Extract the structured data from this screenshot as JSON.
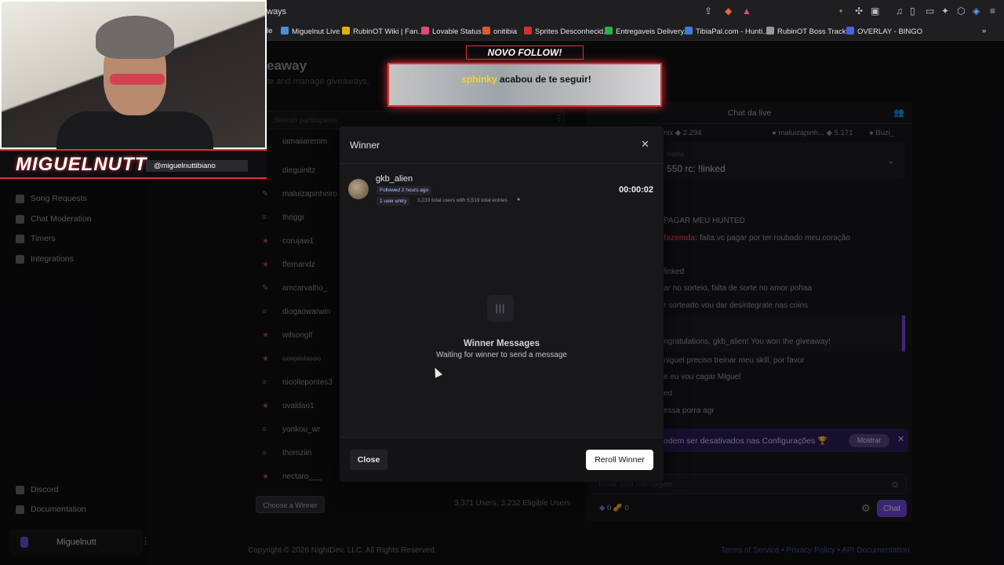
{
  "browser": {
    "url": "ways",
    "bookmarks": [
      {
        "label": "le",
        "color": "#888888"
      },
      {
        "label": "Miguelnut Live",
        "color": "#4b90d6"
      },
      {
        "label": "RubinOT Wiki | Fan...",
        "color": "#e0b000"
      },
      {
        "label": "Lovable Status",
        "color": "#e04a7a"
      },
      {
        "label": "onitibia",
        "color": "#e05a30"
      },
      {
        "label": "Sprites Desconhecid...",
        "color": "#d03030"
      },
      {
        "label": "Entregaveis Delivery...",
        "color": "#2fae4a"
      },
      {
        "label": "TibiaPal.com - Hunti...",
        "color": "#3a7fd5"
      },
      {
        "label": "RubinOT Boss Tracker",
        "color": "#999999"
      },
      {
        "label": "OVERLAY - BINGO",
        "color": "#4a62e0"
      }
    ],
    "more": "»"
  },
  "header": {
    "title": "eaway",
    "subtitle": "te and manage giveaways."
  },
  "search": {
    "placeholder": "Search participants"
  },
  "sidebar": {
    "items": [
      {
        "label": "Song Requests"
      },
      {
        "label": "Chat Moderation"
      },
      {
        "label": "Timers"
      },
      {
        "label": "Integrations"
      },
      {
        "label": "Discord"
      },
      {
        "label": "Documentation"
      }
    ],
    "user": "Miguelnutt"
  },
  "participants": [
    {
      "name": "iamaiiaremm",
      "icon": "≡"
    },
    {
      "name": "dieguinitz",
      "icon": "≡"
    },
    {
      "name": "maluizapinheiro",
      "icon": "✎"
    },
    {
      "name": "thriggr",
      "icon": "≡"
    },
    {
      "name": "corujaw1",
      "icon": "★"
    },
    {
      "name": "tfernandz",
      "icon": "★"
    },
    {
      "name": "amcarvalho_",
      "icon": "✎"
    },
    {
      "name": "diogaowarwin",
      "icon": "≡"
    },
    {
      "name": "wilsonglf",
      "icon": "★"
    },
    {
      "name": "corpinhooo",
      "icon": "★"
    },
    {
      "name": "nicollepontes3",
      "icon": "≡"
    },
    {
      "name": "ovaldao1",
      "icon": "★"
    },
    {
      "name": "yonkou_wr",
      "icon": "≡"
    },
    {
      "name": "thomziin",
      "icon": "≡"
    },
    {
      "name": "nectaro___",
      "icon": "★"
    }
  ],
  "footer": {
    "choose_button": "Choose a Winner",
    "users_count": "3,371 Users, 3,232 Eligible Users",
    "copyright": "Copyright © 2026 NightDev, LLC. All Rights Reserved.",
    "links": "Terms of Service • Privacy Policy • API Documentation"
  },
  "chat": {
    "title": "Chat da live",
    "leaders": [
      {
        "text": "nix ◆ 2.294"
      },
      {
        "text": "● maluizapinh... ◆ 5.171"
      },
      {
        "text": "● Buzi_"
      }
    ],
    "pinned_by": "rvalho",
    "pinned_msg": "550 rc: !linked",
    "messages": [
      {
        "who": "",
        "text": "PAGAR MEU HUNTED"
      },
      {
        "who": "fazemda:",
        "text": " falta vc pagar por ter roubado meu coração"
      },
      {
        "who": "",
        "text": "linked"
      },
      {
        "who": "",
        "text": "ar no sorteio, falta de sorte no amor pohaa"
      },
      {
        "who": "",
        "text": "r sorteado vou dar desintegrate nas coins"
      },
      {
        "who": "",
        "text": "ngratulations, gkb_alien! You won the giveaway!"
      },
      {
        "who": "",
        "text": "niguel preciso treinar meu skill, por favor"
      },
      {
        "who": "",
        "text": "e eu vou cagar Miguel"
      },
      {
        "who": "",
        "text": "ed"
      },
      {
        "who": "",
        "text": "essa porra agr"
      }
    ],
    "notice": "odem ser desativados nas Configurações 🏆",
    "notice_button": "Mostrar",
    "input_placeholder": "Envie uma mensagem",
    "points": "0  🥜 0",
    "send_button": "Chat"
  },
  "modal": {
    "title": "Winner",
    "winner_name": "gkb_alien",
    "followed": "Followed 2 hours ago",
    "entries_badge": "1 user entry",
    "entries_info": "3,233 total users with 5,519 total entries",
    "timer": "00:00:02",
    "empty_icon": "|||",
    "msg_title": "Winner Messages",
    "msg_sub": "Waiting for winner to send a message",
    "close_button": "Close",
    "reroll_button": "Reroll Winner"
  },
  "follow_alert": {
    "label_a": "NOVO",
    "label_b": "FOLLOW!",
    "user": "sphinky",
    "text": " acabou de te seguir!"
  },
  "cam": {
    "name": "MIGUELNUTT",
    "handle": "@miguelnuttibiano"
  }
}
